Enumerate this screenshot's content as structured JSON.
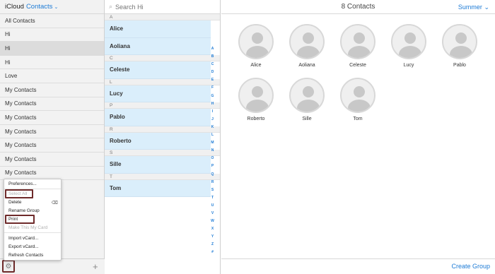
{
  "header": {
    "brand": "iCloud",
    "app": "Contacts",
    "chevron": "⌄"
  },
  "groups": [
    "All Contacts",
    "Hi",
    "Hi",
    "Hi",
    "Love",
    "My Contacts",
    "My Contacts",
    "My Contacts",
    "My Contacts",
    "My Contacts",
    "My Contacts",
    "My Contacts"
  ],
  "search": {
    "placeholder": "Search Hi"
  },
  "menu": {
    "preferences": "Preferences...",
    "select_all": "Select All",
    "delete": "Delete",
    "rename_group": "Rename Group",
    "print": "Print",
    "make_my_card": "Make This My Card",
    "import_vcard": "Import vCard...",
    "export_vcard": "Export vCard...",
    "refresh": "Refresh Contacts"
  },
  "sections": [
    {
      "letter": "A",
      "contacts": [
        "Alice",
        "Aoliana"
      ]
    },
    {
      "letter": "C",
      "contacts": [
        "Celeste"
      ]
    },
    {
      "letter": "L",
      "contacts": [
        "Lucy"
      ]
    },
    {
      "letter": "P",
      "contacts": [
        "Pablo"
      ]
    },
    {
      "letter": "R",
      "contacts": [
        "Roberto"
      ]
    },
    {
      "letter": "S",
      "contacts": [
        "Sille"
      ]
    },
    {
      "letter": "T",
      "contacts": [
        "Tom"
      ]
    }
  ],
  "index_letters": [
    "A",
    "B",
    "C",
    "D",
    "E",
    "F",
    "G",
    "H",
    "I",
    "J",
    "K",
    "L",
    "M",
    "N",
    "O",
    "P",
    "Q",
    "R",
    "S",
    "T",
    "U",
    "V",
    "W",
    "X",
    "Y",
    "Z",
    "#"
  ],
  "cards_header": {
    "count": "8 Contacts",
    "user": "Summer"
  },
  "cards": [
    "Alice",
    "Aoliana",
    "Celeste",
    "Lucy",
    "Pablo",
    "Roberto",
    "Sille",
    "Tom"
  ],
  "footer": {
    "create_group": "Create Group",
    "plus": "+"
  },
  "colors": {
    "accent": "#1d7bd6",
    "highlight": "#6e2a2a",
    "selected_row": "#daeefb"
  },
  "icons": {
    "search": "search-icon",
    "gear": "gear-icon",
    "delete": "delete-key-icon"
  }
}
